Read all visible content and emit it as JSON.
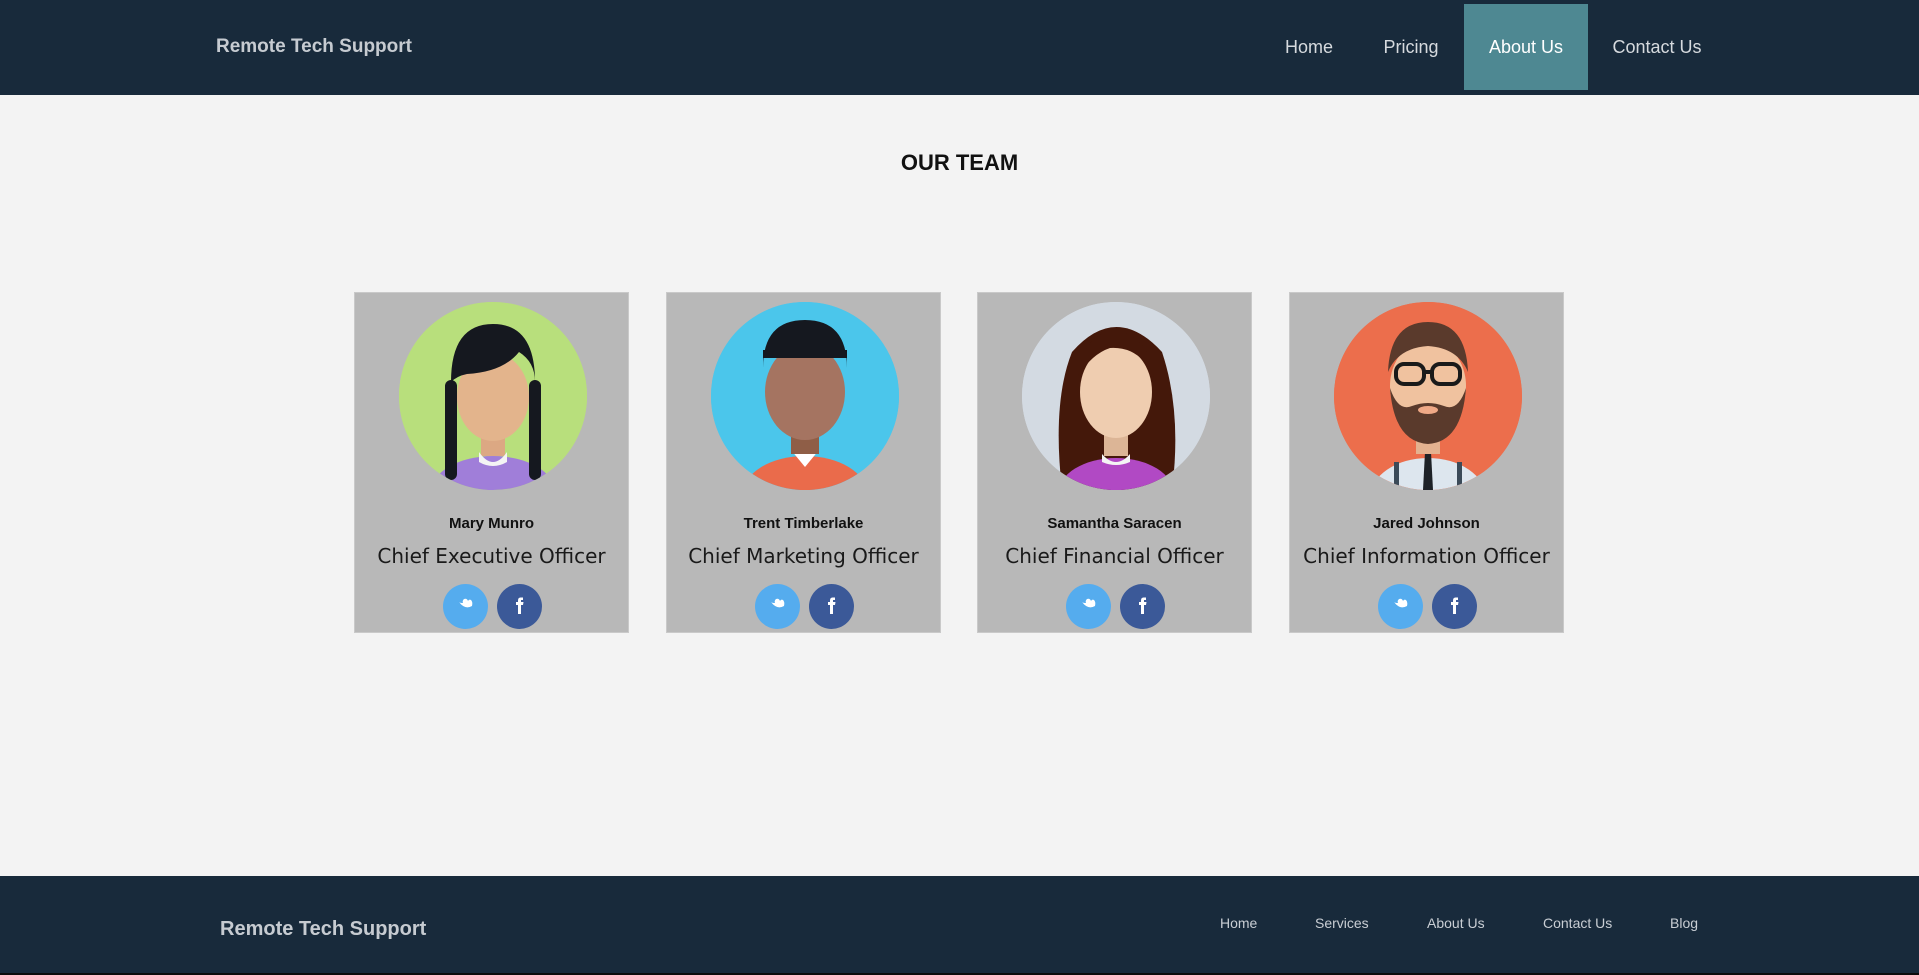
{
  "header": {
    "brand": "Remote Tech Support",
    "nav": [
      {
        "label": "Home",
        "active": false
      },
      {
        "label": "Pricing",
        "active": false
      },
      {
        "label": "About Us",
        "active": true
      },
      {
        "label": "Contact Us",
        "active": false
      }
    ]
  },
  "main": {
    "title": "OUR TEAM",
    "team": [
      {
        "name": "Mary Munro",
        "role": "Chief Executive Officer",
        "avatar": "woman-braids-avatar",
        "bg": "#b8df7c"
      },
      {
        "name": "Trent Timberlake",
        "role": "Chief Marketing Officer",
        "avatar": "man-avatar",
        "bg": "#4bc6eb"
      },
      {
        "name": "Samantha Saracen",
        "role": "Chief Financial Officer",
        "avatar": "woman-long-hair-avatar",
        "bg": "#d3dae2"
      },
      {
        "name": "Jared Johnson",
        "role": "Chief Information Officer",
        "avatar": "man-beard-glasses-avatar",
        "bg": "#ec6e4c"
      }
    ],
    "social_icons": [
      "twitter-icon",
      "facebook-icon"
    ]
  },
  "footer": {
    "brand": "Remote Tech Support",
    "links": [
      "Home",
      "Services",
      "About Us",
      "Contact Us",
      "Blog"
    ]
  },
  "colors": {
    "header_bg": "#182a3b",
    "nav_active": "#4e8892",
    "page_bg": "#f3f3f3",
    "card_bg": "#b8b8b8",
    "twitter": "#55acee",
    "facebook": "#3b5998"
  }
}
